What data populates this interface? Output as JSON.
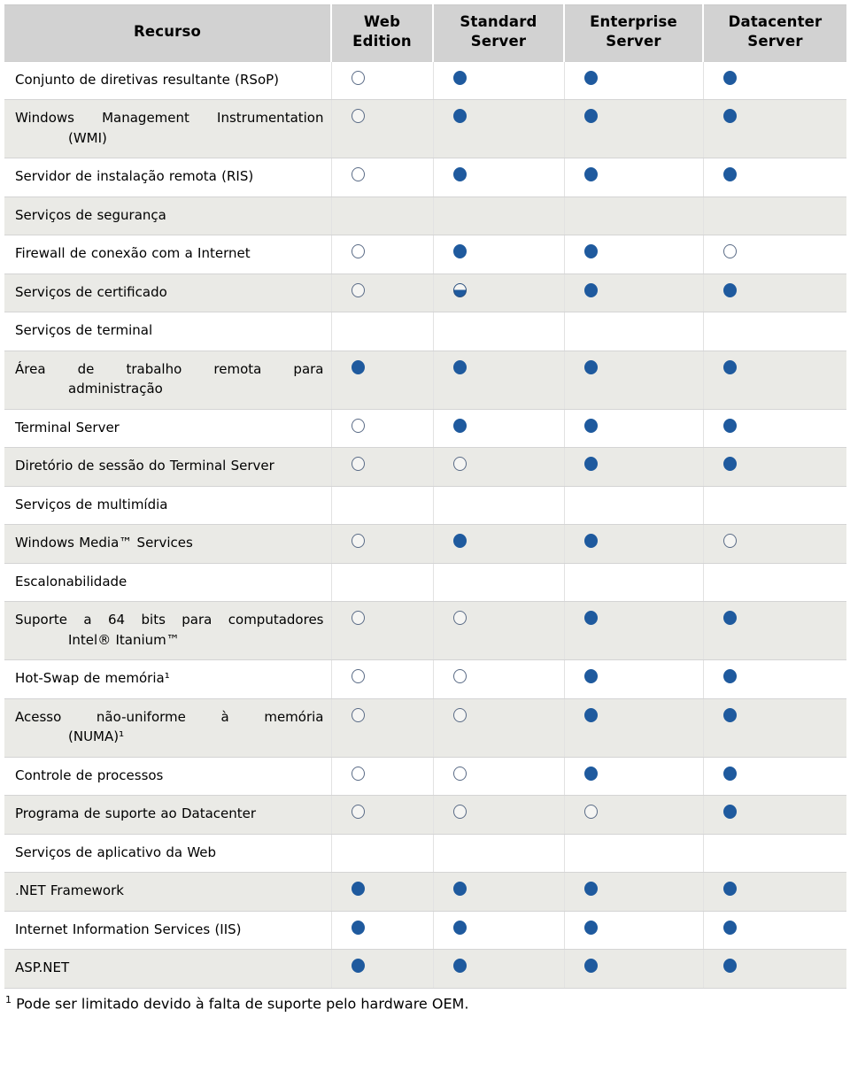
{
  "table": {
    "columns": [
      {
        "key": "resource",
        "label_lines": [
          "Recurso"
        ]
      },
      {
        "key": "web",
        "label_lines": [
          "Web",
          "Edition"
        ]
      },
      {
        "key": "standard",
        "label_lines": [
          "Standard",
          "Server"
        ]
      },
      {
        "key": "enterprise",
        "label_lines": [
          "Enterprise",
          "Server"
        ]
      },
      {
        "key": "datacenter",
        "label_lines": [
          "Datacenter",
          "Server"
        ]
      }
    ],
    "legend_states": {
      "full": "circulo-preenchido",
      "empty": "circulo-vazio",
      "half": "circulo-meio-preenchido",
      "none": "sem-marcador"
    },
    "rows": [
      {
        "type": "feature",
        "feature": "Conjunto de diretivas resultante (RSoP)",
        "feature_lines": [
          "Conjunto de diretivas resultante (RSoP)"
        ],
        "web": "empty",
        "standard": "full",
        "enterprise": "full",
        "datacenter": "full"
      },
      {
        "type": "feature",
        "feature": "Windows Management Instrumentation (WMI)",
        "feature_lines": [
          "Windows  Management  Instrumentation",
          "(WMI)"
        ],
        "web": "empty",
        "standard": "full",
        "enterprise": "full",
        "datacenter": "full"
      },
      {
        "type": "feature",
        "feature": "Servidor de instalação remota (RIS)",
        "feature_lines": [
          "Servidor de instalação remota (RIS)"
        ],
        "web": "empty",
        "standard": "full",
        "enterprise": "full",
        "datacenter": "full"
      },
      {
        "type": "section",
        "feature": "Serviços de segurança",
        "feature_lines": [
          "Serviços de segurança"
        ],
        "web": "none",
        "standard": "none",
        "enterprise": "none",
        "datacenter": "none"
      },
      {
        "type": "feature",
        "feature": "Firewall de conexão com a Internet",
        "feature_lines": [
          "Firewall de conexão com a Internet"
        ],
        "web": "empty",
        "standard": "full",
        "enterprise": "full",
        "datacenter": "empty"
      },
      {
        "type": "feature",
        "feature": "Serviços de certificado",
        "feature_lines": [
          "Serviços de certificado"
        ],
        "web": "empty",
        "standard": "half",
        "enterprise": "full",
        "datacenter": "full"
      },
      {
        "type": "section",
        "feature": "Serviços de terminal",
        "feature_lines": [
          "Serviços de terminal"
        ],
        "web": "none",
        "standard": "none",
        "enterprise": "none",
        "datacenter": "none"
      },
      {
        "type": "feature",
        "feature": "Área de trabalho remota para administração",
        "feature_lines": [
          "Área  de  trabalho  remota  para",
          "administração"
        ],
        "web": "full",
        "standard": "full",
        "enterprise": "full",
        "datacenter": "full"
      },
      {
        "type": "feature",
        "feature": "Terminal Server",
        "feature_lines": [
          "Terminal Server"
        ],
        "web": "empty",
        "standard": "full",
        "enterprise": "full",
        "datacenter": "full"
      },
      {
        "type": "feature",
        "feature": "Diretório de sessão do Terminal Server",
        "feature_lines": [
          "Diretório de sessão do Terminal Server"
        ],
        "web": "empty",
        "standard": "empty",
        "enterprise": "full",
        "datacenter": "full"
      },
      {
        "type": "section",
        "feature": "Serviços de multimídia",
        "feature_lines": [
          "Serviços de multimídia"
        ],
        "web": "none",
        "standard": "none",
        "enterprise": "none",
        "datacenter": "none"
      },
      {
        "type": "feature",
        "feature": "Windows Media™ Services",
        "feature_lines": [
          "Windows Media™ Services"
        ],
        "web": "empty",
        "standard": "full",
        "enterprise": "full",
        "datacenter": "empty"
      },
      {
        "type": "section",
        "feature": "Escalonabilidade",
        "feature_lines": [
          "Escalonabilidade"
        ],
        "web": "none",
        "standard": "none",
        "enterprise": "none",
        "datacenter": "none"
      },
      {
        "type": "feature",
        "feature": "Suporte a 64 bits para computadores Intel® Itanium™",
        "feature_lines": [
          "Suporte  a  64  bits  para  computadores",
          "Intel®  Itanium™"
        ],
        "web": "empty",
        "standard": "empty",
        "enterprise": "full",
        "datacenter": "full"
      },
      {
        "type": "feature",
        "feature": "Hot-Swap de memória¹",
        "feature_lines": [
          "Hot-Swap de memória¹"
        ],
        "web": "empty",
        "standard": "empty",
        "enterprise": "full",
        "datacenter": "full"
      },
      {
        "type": "feature",
        "feature": "Acesso não-uniforme à memória (NUMA)¹",
        "feature_lines": [
          "Acesso  não-uniforme  à  memória",
          "(NUMA)¹"
        ],
        "web": "empty",
        "standard": "empty",
        "enterprise": "full",
        "datacenter": "full"
      },
      {
        "type": "feature",
        "feature": "Controle de processos",
        "feature_lines": [
          "Controle de processos"
        ],
        "web": "empty",
        "standard": "empty",
        "enterprise": "full",
        "datacenter": "full"
      },
      {
        "type": "feature",
        "feature": "Programa de suporte ao Datacenter",
        "feature_lines": [
          "Programa de suporte ao Datacenter"
        ],
        "web": "empty",
        "standard": "empty",
        "enterprise": "empty",
        "datacenter": "full"
      },
      {
        "type": "section",
        "feature": "Serviços de aplicativo da Web",
        "feature_lines": [
          "Serviços de aplicativo da Web"
        ],
        "web": "none",
        "standard": "none",
        "enterprise": "none",
        "datacenter": "none"
      },
      {
        "type": "feature",
        "feature": ".NET Framework",
        "feature_lines": [
          ".NET Framework"
        ],
        "web": "full",
        "standard": "full",
        "enterprise": "full",
        "datacenter": "full"
      },
      {
        "type": "feature",
        "feature": "Internet Information Services (IIS)",
        "feature_lines": [
          "Internet Information Services (IIS)"
        ],
        "web": "full",
        "standard": "full",
        "enterprise": "full",
        "datacenter": "full"
      },
      {
        "type": "feature",
        "feature": "ASP.NET",
        "feature_lines": [
          "ASP.NET"
        ],
        "web": "full",
        "standard": "full",
        "enterprise": "full",
        "datacenter": "full"
      }
    ]
  },
  "footnote": {
    "marker": "1",
    "text": " Pode ser limitado devido à falta de suporte pelo hardware OEM."
  },
  "colors": {
    "accent_blue": "#1f5a9e",
    "header_bg": "#d2d2d2",
    "row_alt_bg": "#eaeae6",
    "row_bg": "#ffffff",
    "border": "#d4d4d4"
  }
}
